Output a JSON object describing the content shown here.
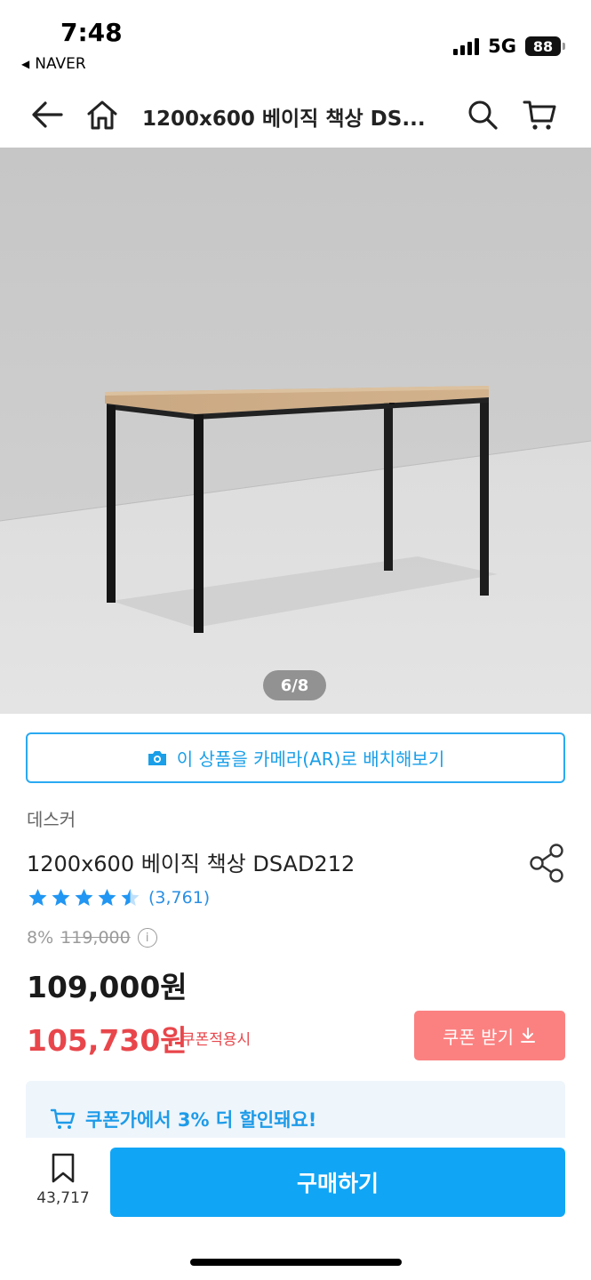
{
  "status_bar": {
    "time": "7:48",
    "back_app": "NAVER",
    "network": "5G",
    "battery": "88"
  },
  "nav": {
    "title": "1200x600 베이직 책상 DS...",
    "icons": [
      "back-arrow-icon",
      "home-icon",
      "search-icon",
      "cart-icon"
    ]
  },
  "gallery": {
    "counter": "6/8"
  },
  "ar_button": {
    "label": "이 상품을 카메라(AR)로 배치해보기"
  },
  "product": {
    "brand": "데스커",
    "title": "1200x600 베이직 책상 DSAD212",
    "rating_stars": 4.5,
    "review_count": "(3,761)",
    "discount_percent": "8%",
    "original_price": "119,000",
    "price": "109,000원",
    "coupon_price": "105,730원",
    "coupon_note": "쿠폰적용시",
    "coupon_button": "쿠폰 받기",
    "promo": "쿠폰가에서 3% 더 할인돼요!"
  },
  "bottom_bar": {
    "bookmark_count": "43,717",
    "buy_label": "구매하기"
  },
  "colors": {
    "accent_blue": "#11a5f5",
    "sale_red": "#e8464b",
    "coupon_button": "#fb8181",
    "star_blue": "#2196f3"
  }
}
